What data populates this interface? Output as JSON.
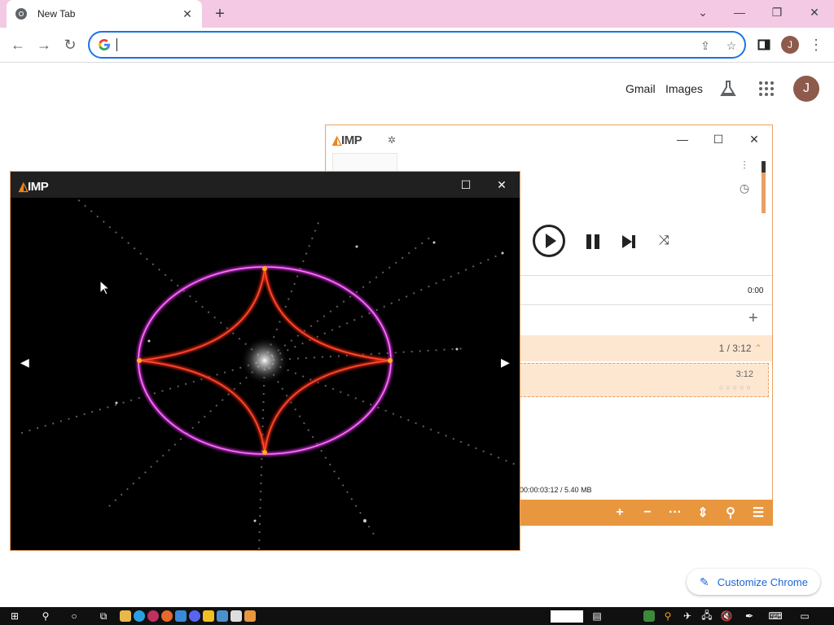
{
  "browser": {
    "tab_title": "New Tab",
    "omnibox_value": "",
    "avatar_letter": "J"
  },
  "ntp": {
    "gmail": "Gmail",
    "images": "Images",
    "avatar_letter": "J",
    "customize": "Customize Chrome"
  },
  "aimp_main": {
    "logo": "IMP",
    "time": "0:00",
    "group_info": "1 / 3:12",
    "item_duration": "3:12",
    "item_stars": "○○○○○",
    "status": "00:00:03:12 / 5.40 MB"
  },
  "aimp_viz": {
    "logo": "IMP"
  },
  "colors": {
    "accent": "#e8973f",
    "tab_strip": "#f3c9e3",
    "omnibox_border": "#1a73e8"
  }
}
